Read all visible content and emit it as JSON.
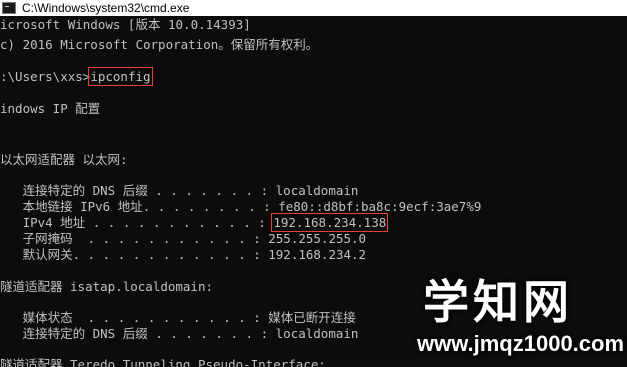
{
  "window": {
    "title": "C:\\Windows\\system32\\cmd.exe",
    "icon": "cmd-console-icon"
  },
  "console": {
    "lines": [
      "icrosoft Windows [版本 10.0.14393]",
      "c) 2016 Microsoft Corporation。保留所有权利。",
      ":\\Users\\xxs>",
      "ipconfig",
      "indows IP 配置",
      "以太网适配器 以太网:",
      "   连接特定的 DNS 后缀 . . . . . . . : localdomain",
      "   本地链接 IPv6 地址. . . . . . . . : fe80::d8bf:ba8c:9ecf:3ae7%9",
      "   IPv4 地址 . . . . . . . . . . . : ",
      "192.168.234.138",
      "   子网掩码  . . . . . . . . . . . : 255.255.255.0",
      "   默认网关. . . . . . . . . . . . : 192.168.234.2",
      "隧道适配器 isatap.localdomain:",
      "   媒体状态  . . . . . . . . . . . : 媒体已断开连接",
      "   连接特定的 DNS 后缀 . . . . . . . : localdomain",
      "隧道适配器 Teredo Tunneling Pseudo-Interface:"
    ]
  },
  "watermark": {
    "text": "学知网",
    "url": "www.jmqz1000.com"
  },
  "colors": {
    "console_bg": "#0c0c0c",
    "console_fg": "#c0c0c0",
    "highlight_box": "#e0442f",
    "titlebar_bg": "#ffffff"
  }
}
